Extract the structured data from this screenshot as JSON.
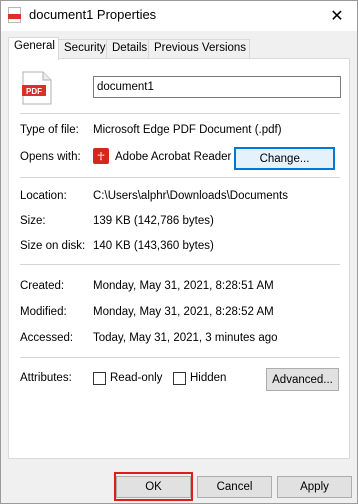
{
  "window": {
    "title": "document1 Properties",
    "title_icon": "pdf-file-icon",
    "close_glyph": "✕"
  },
  "tabs": [
    {
      "label": "General",
      "active": true
    },
    {
      "label": "Security",
      "active": false
    },
    {
      "label": "Details",
      "active": false
    },
    {
      "label": "Previous Versions",
      "active": false
    }
  ],
  "general": {
    "file_icon_label": "PDF",
    "file_name": "document1",
    "type_label": "Type of file:",
    "type_value": "Microsoft Edge PDF Document (.pdf)",
    "opens_label": "Opens with:",
    "opens_value": "Adobe Acrobat Reader",
    "change_button": "Change...",
    "location_label": "Location:",
    "location_value": "C:\\Users\\alphr\\Downloads\\Documents",
    "size_label": "Size:",
    "size_value": "139 KB (142,786 bytes)",
    "size_on_disk_label": "Size on disk:",
    "size_on_disk_value": "140 KB (143,360 bytes)",
    "created_label": "Created:",
    "created_value": "Monday, May 31, 2021, 8:28:51 AM",
    "modified_label": "Modified:",
    "modified_value": "Monday, May 31, 2021, 8:28:52 AM",
    "accessed_label": "Accessed:",
    "accessed_value": "Today, May 31, 2021, 3 minutes ago",
    "attributes_label": "Attributes:",
    "readonly_label": "Read-only",
    "readonly_checked": false,
    "hidden_label": "Hidden",
    "hidden_checked": false,
    "advanced_button": "Advanced..."
  },
  "footer": {
    "ok": "OK",
    "cancel": "Cancel",
    "apply": "Apply"
  },
  "colors": {
    "accent": "#0078d7",
    "pdf_red": "#d9302a",
    "highlight_red": "#e21b1b"
  }
}
